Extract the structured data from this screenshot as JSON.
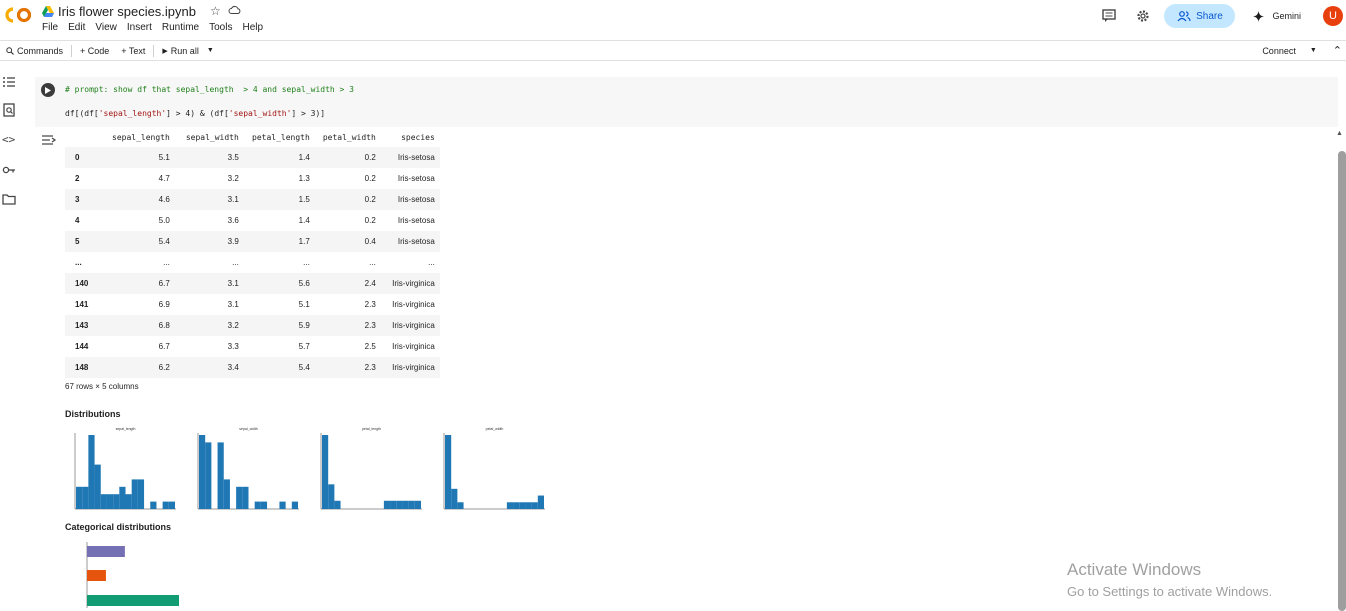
{
  "header": {
    "notebook_title": "Iris flower species.ipynb",
    "menu": [
      "File",
      "Edit",
      "View",
      "Insert",
      "Runtime",
      "Tools",
      "Help"
    ],
    "share_label": "Share",
    "gemini_label": "Gemini",
    "avatar_letter": "U",
    "icons": [
      "colab-logo",
      "drive-icon",
      "star-icon",
      "cloud-icon",
      "comment-icon",
      "gear-icon",
      "share-people-icon",
      "gemini-spark-icon"
    ],
    "colors": {
      "share_bg": "#c2e7ff",
      "share_text": "#0b57d0",
      "avatar_bg": "#e8400c",
      "logo_orange": "#f9ab00",
      "logo_orange_dark": "#e37400"
    }
  },
  "toolbar": {
    "commands_label": "Commands",
    "code_label": "+ Code",
    "text_label": "+ Text",
    "run_all_label": "Run all",
    "connect_label": "Connect"
  },
  "cell": {
    "comment": "# prompt: show df that sepal_length  > 4 and sepal_width > 3",
    "code_prefix": "df[(df[",
    "code_s1": "'sepal_length'",
    "code_mid": "] > 4) & (df[",
    "code_s2": "'sepal_width'",
    "code_suffix": "] > 3)]"
  },
  "output": {
    "columns": [
      "sepal_length",
      "sepal_width",
      "petal_length",
      "petal_width",
      "species"
    ],
    "rows": [
      {
        "index": "0",
        "cells": [
          "5.1",
          "3.5",
          "1.4",
          "0.2",
          "Iris-setosa"
        ]
      },
      {
        "index": "2",
        "cells": [
          "4.7",
          "3.2",
          "1.3",
          "0.2",
          "Iris-setosa"
        ]
      },
      {
        "index": "3",
        "cells": [
          "4.6",
          "3.1",
          "1.5",
          "0.2",
          "Iris-setosa"
        ]
      },
      {
        "index": "4",
        "cells": [
          "5.0",
          "3.6",
          "1.4",
          "0.2",
          "Iris-setosa"
        ]
      },
      {
        "index": "5",
        "cells": [
          "5.4",
          "3.9",
          "1.7",
          "0.4",
          "Iris-setosa"
        ]
      },
      {
        "index": "...",
        "cells": [
          "...",
          "...",
          "...",
          "...",
          "..."
        ]
      },
      {
        "index": "140",
        "cells": [
          "6.7",
          "3.1",
          "5.6",
          "2.4",
          "Iris-virginica"
        ]
      },
      {
        "index": "141",
        "cells": [
          "6.9",
          "3.1",
          "5.1",
          "2.3",
          "Iris-virginica"
        ]
      },
      {
        "index": "143",
        "cells": [
          "6.8",
          "3.2",
          "5.9",
          "2.3",
          "Iris-virginica"
        ]
      },
      {
        "index": "144",
        "cells": [
          "6.7",
          "3.3",
          "5.7",
          "2.5",
          "Iris-virginica"
        ]
      },
      {
        "index": "148",
        "cells": [
          "6.2",
          "3.4",
          "5.4",
          "2.3",
          "Iris-virginica"
        ]
      }
    ],
    "shape_text": "67 rows × 5 columns",
    "distributions_title": "Distributions",
    "categorical_title": "Categorical distributions"
  },
  "chart_data": [
    {
      "type": "bar",
      "title": "sepal_length",
      "values": [
        3,
        3,
        10,
        6,
        2,
        2,
        2,
        3,
        2,
        4,
        4,
        0,
        1,
        0,
        1,
        1
      ],
      "color": "#1f77b4"
    },
    {
      "type": "bar",
      "title": "sepal_width",
      "values": [
        10,
        9,
        0,
        9,
        4,
        0,
        3,
        3,
        0,
        1,
        1,
        0,
        0,
        1,
        0,
        1
      ],
      "color": "#1f77b4"
    },
    {
      "type": "bar",
      "title": "petal_length",
      "values": [
        9,
        3,
        1,
        0,
        0,
        0,
        0,
        0,
        0,
        0,
        1,
        1,
        1,
        1,
        1,
        1
      ],
      "color": "#1f77b4"
    },
    {
      "type": "bar",
      "title": "petal_width",
      "values": [
        11,
        3,
        1,
        0,
        0,
        0,
        0,
        0,
        0,
        0,
        1,
        1,
        1,
        1,
        1,
        2
      ],
      "color": "#1f77b4"
    },
    {
      "type": "bar",
      "orientation": "horizontal",
      "title": "species",
      "values": [
        14,
        7,
        34
      ],
      "colors": [
        "#7570b3",
        "#e6550d",
        "#129c73"
      ]
    }
  ],
  "watermark": {
    "line1": "Activate Windows",
    "line2": "Go to Settings to activate Windows."
  }
}
